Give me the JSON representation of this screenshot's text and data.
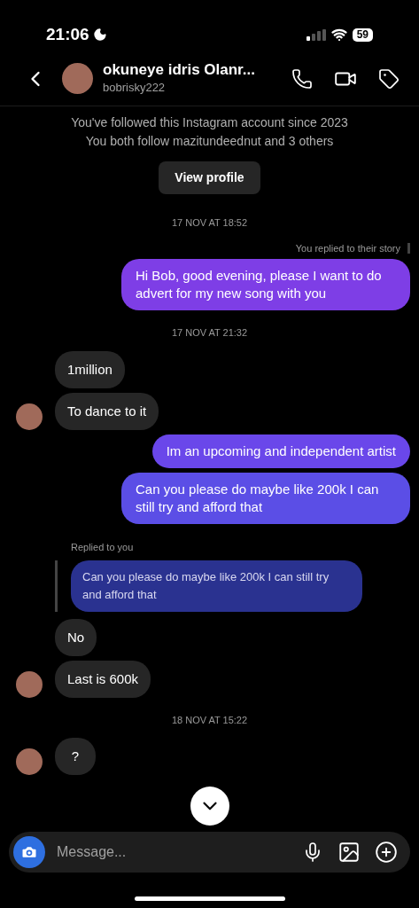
{
  "status_bar": {
    "time": "21:06",
    "battery": "59"
  },
  "header": {
    "name": "okuneye idris Olanr...",
    "username": "bobrisky222"
  },
  "profile_info": {
    "lines": [
      "You've followed this Instagram account since 2023",
      "You both follow mazitundeednut and 3 others"
    ],
    "button": "View profile"
  },
  "messages": [
    {
      "kind": "timestamp",
      "text": "17 NOV AT 18:52"
    },
    {
      "kind": "note",
      "text": "You replied to their story"
    },
    {
      "kind": "outgoing",
      "text": "Hi Bob, good evening, please I want to do advert for my new song with you",
      "color": "#7e3ee6"
    },
    {
      "kind": "timestamp",
      "text": "17 NOV AT 21:32"
    },
    {
      "kind": "incoming",
      "text": "1million",
      "avatar": false
    },
    {
      "kind": "incoming",
      "text": "To dance to it",
      "avatar": true
    },
    {
      "kind": "outgoing",
      "text": "Im an upcoming and independent artist",
      "color": "#6a47ea"
    },
    {
      "kind": "outgoing",
      "text": "Can you please do maybe like 200k I can still try and afford that",
      "color": "#5b4ee6"
    },
    {
      "kind": "note_left",
      "text": "Replied to you"
    },
    {
      "kind": "quote",
      "text": "Can you please do maybe like 200k I can still try and afford that",
      "color": "#2a3290"
    },
    {
      "kind": "incoming",
      "text": "No",
      "avatar": false
    },
    {
      "kind": "incoming",
      "text": "Last is 600k",
      "avatar": true
    },
    {
      "kind": "timestamp",
      "text": "18 NOV AT 15:22"
    },
    {
      "kind": "incoming",
      "text": "?",
      "avatar": true
    }
  ],
  "composer": {
    "placeholder": "Message..."
  }
}
